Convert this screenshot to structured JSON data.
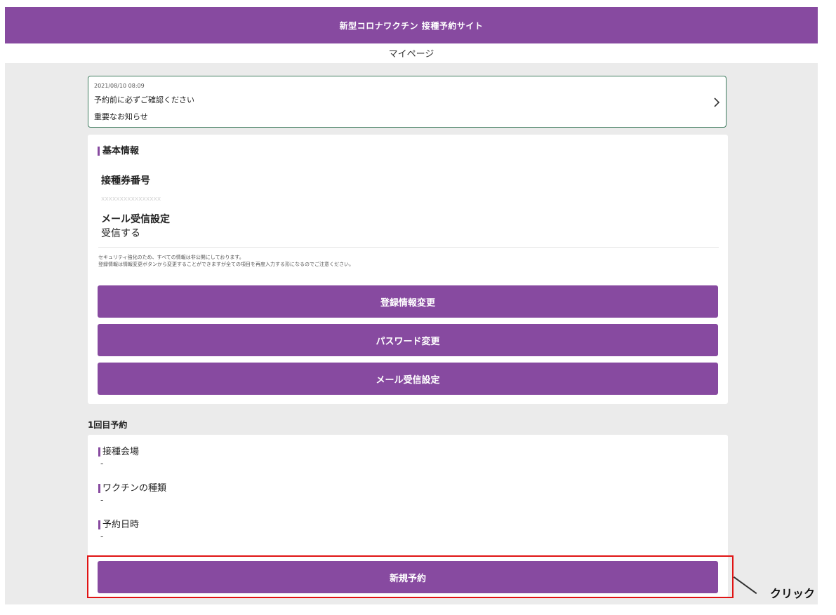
{
  "header": {
    "title": "新型コロナワクチン 接種予約サイト"
  },
  "page_title": "マイページ",
  "notice": {
    "date": "2021/08/10 08:09",
    "title": "予約前に必ずご確認ください",
    "subtitle": "重要なお知らせ",
    "chevron_icon": "chevron-right-icon"
  },
  "basic_info": {
    "section_title": "基本情報",
    "ticket_label": "接種券番号",
    "ticket_value": "xxxxxxxxxxxxxxxx",
    "mail_label": "メール受信設定",
    "mail_value": "受信する",
    "note_line1": "セキュリティ強化のため、すべての情報は非公開にしております。",
    "note_line2": "登録情報は情報変更ボタンから変更することができますが全ての項目を再度入力する形になるのでご注意ください。",
    "buttons": {
      "edit_registration": "登録情報変更",
      "change_password": "パスワード変更",
      "mail_settings": "メール受信設定"
    }
  },
  "reservation": {
    "heading": "1回目予約",
    "venue_label": "接種会場",
    "venue_value": "-",
    "vaccine_label": "ワクチンの種類",
    "vaccine_value": "-",
    "datetime_label": "予約日時",
    "datetime_value": "-",
    "new_reservation_button": "新規予約"
  },
  "annotation": {
    "text": "クリック",
    "color": "#e01414"
  },
  "colors": {
    "brand": "#874aa0",
    "background": "#ebebeb",
    "notice_border": "#3f7b5f"
  }
}
